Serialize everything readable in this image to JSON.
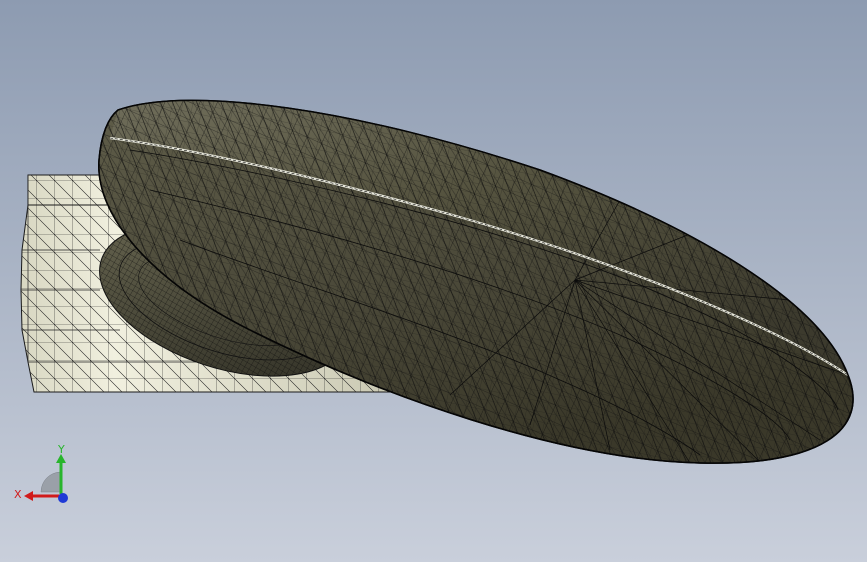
{
  "viewport": {
    "background_top": "#8d9bb1",
    "background_bottom": "#c9cfdb",
    "model": {
      "display_mode": "shaded-with-mesh",
      "body_color": "#4f4d3f",
      "body_color_light": "#8a8770",
      "block_color": "#d9d8c4",
      "block_color_light": "#f3f2e2",
      "mesh_color": "#111111"
    },
    "triad": {
      "x_label": "X",
      "y_label": "Y",
      "x_color": "#d11b1b",
      "y_color": "#28b52c",
      "z_color": "#1f3ad6"
    }
  }
}
